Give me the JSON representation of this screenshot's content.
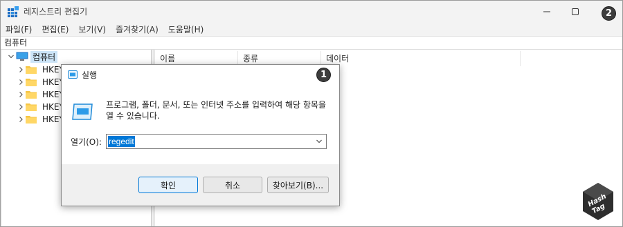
{
  "window": {
    "title": "레지스트리 편집기",
    "minimize_icon": "minimize-icon",
    "maximize_icon": "maximize-icon"
  },
  "badges": {
    "window_step": "2",
    "run_step": "1"
  },
  "menu": {
    "items": [
      {
        "label": "파일(F)"
      },
      {
        "label": "편집(E)"
      },
      {
        "label": "보기(V)"
      },
      {
        "label": "즐겨찾기(A)"
      },
      {
        "label": "도움말(H)"
      }
    ]
  },
  "address": {
    "path": "컴퓨터"
  },
  "tree": {
    "root": {
      "label": "컴퓨터",
      "icon": "computer-icon",
      "expanded": true
    },
    "children": [
      {
        "label": "HKEY_CLASSES_ROOT",
        "icon": "folder-icon"
      },
      {
        "label": "HKEY_CURRENT_USER",
        "icon": "folder-icon"
      },
      {
        "label": "HKEY_LOCAL_MACHINE",
        "icon": "folder-icon"
      },
      {
        "label": "HKEY_USERS",
        "icon": "folder-icon"
      },
      {
        "label": "HKEY_CURRENT_CONFIG",
        "icon": "folder-icon"
      }
    ]
  },
  "list": {
    "columns": [
      {
        "label": "이름"
      },
      {
        "label": "종류"
      },
      {
        "label": "데이터"
      }
    ]
  },
  "run_dialog": {
    "title": "실행",
    "description": "프로그램, 폴더, 문서, 또는 인터넷 주소를 입력하여 해당 항목을 열 수 있습니다.",
    "open_label": "열기(O):",
    "input_value": "regedit",
    "buttons": {
      "ok": "확인",
      "cancel": "취소",
      "browse": "찾아보기(B)..."
    }
  },
  "watermark": {
    "line1": "Hash",
    "line2": "Tag"
  },
  "colors": {
    "selection": "#0078d7",
    "tree_selection": "#cce4f7",
    "folder": "#f6c544",
    "badge": "#3d3d3d"
  }
}
